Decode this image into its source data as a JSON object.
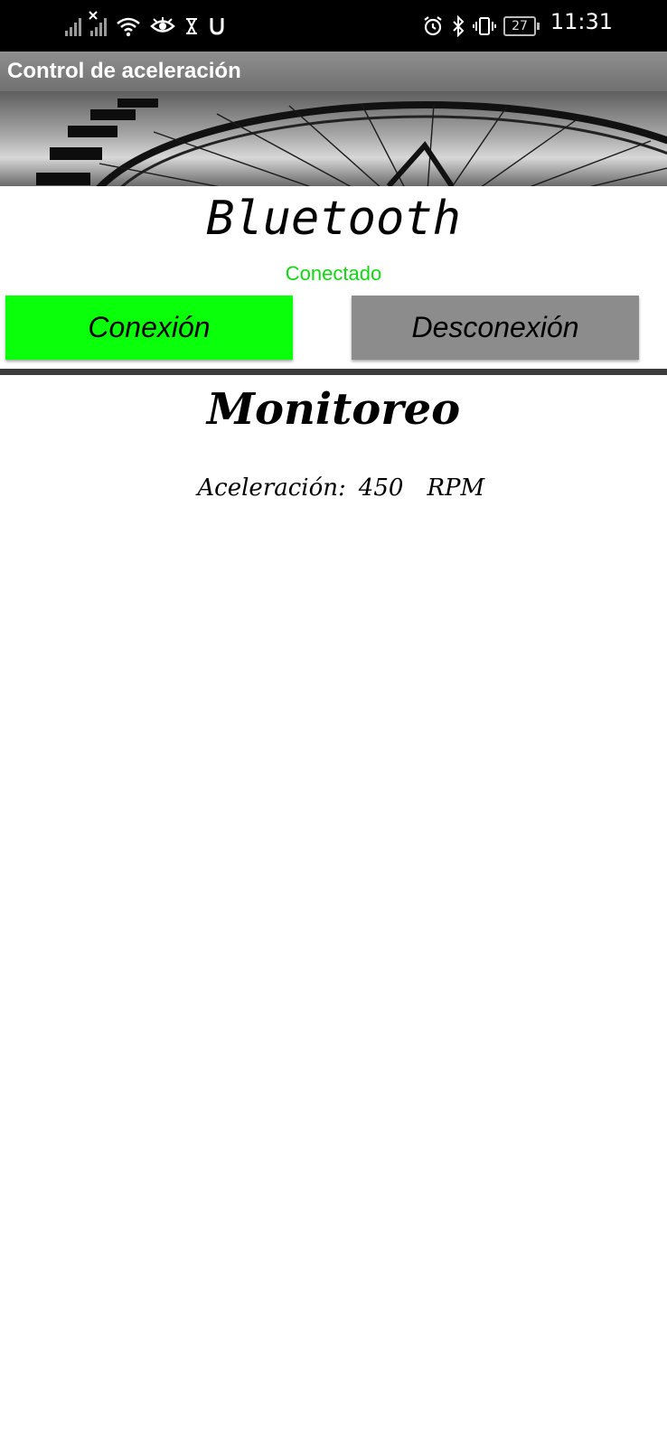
{
  "status_bar": {
    "time": "11:31",
    "battery_level": "27",
    "left_icons": [
      "signal-icon",
      "signal-no-service-icon",
      "wifi-icon",
      "eye-icon",
      "hourglass-icon",
      "u-icon"
    ],
    "right_icons": [
      "alarm-icon",
      "bluetooth-icon",
      "vibrate-icon",
      "battery-icon"
    ]
  },
  "app": {
    "title": "Control de aceleración"
  },
  "bluetooth": {
    "title": "Bluetooth",
    "status": "Conectado",
    "status_color": "#11d611",
    "connect_label": "Conexión",
    "connect_color": "#0aff0a",
    "disconnect_label": "Desconexión",
    "disconnect_color": "#8c8c8c"
  },
  "monitoring": {
    "title": "Monitoreo",
    "acceleration_label": "Aceleración:",
    "acceleration_value": "450",
    "acceleration_unit": "RPM"
  }
}
